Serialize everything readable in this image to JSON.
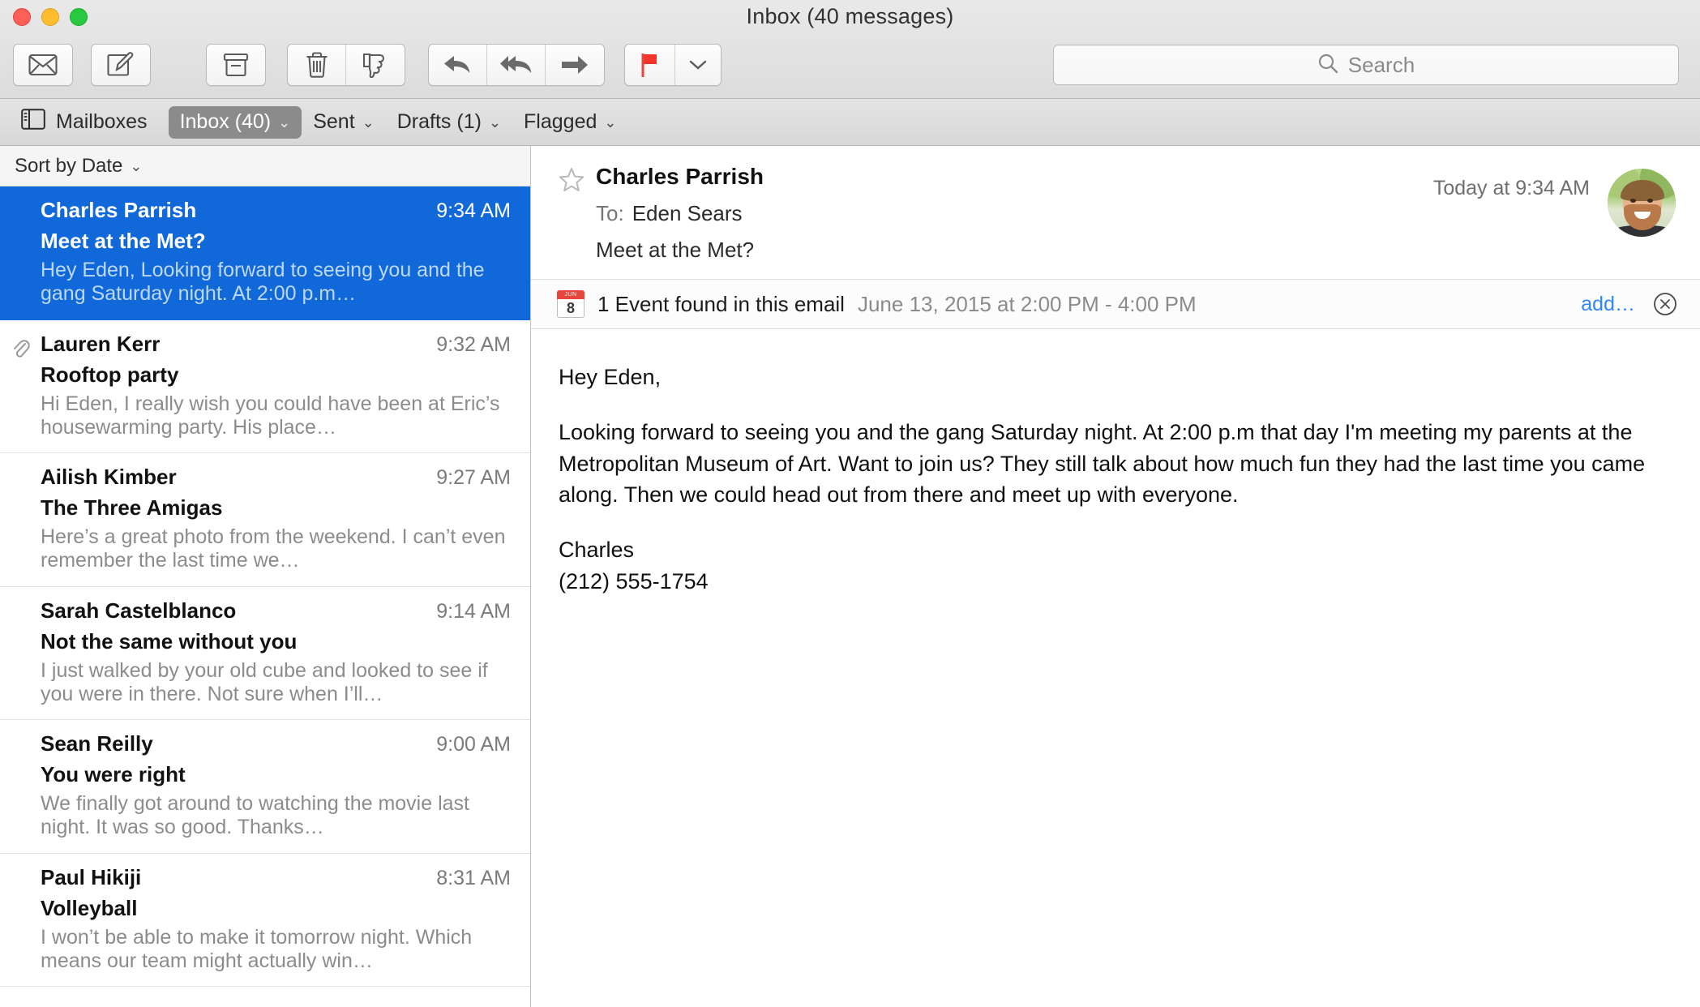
{
  "window": {
    "title": "Inbox (40 messages)",
    "traffic_lights": [
      "close",
      "minimize",
      "zoom"
    ]
  },
  "toolbar": {
    "buttons": [
      {
        "name": "get-mail-button",
        "icon": "envelope-icon",
        "label": "Get Mail"
      },
      {
        "name": "compose-button",
        "icon": "compose-icon",
        "label": "New Message"
      },
      {
        "name": "archive-button",
        "icon": "archive-box-icon",
        "label": "Archive"
      },
      {
        "name": "delete-button",
        "icon": "trash-icon",
        "label": "Delete"
      },
      {
        "name": "junk-button",
        "icon": "thumbs-down-icon",
        "label": "Mark as Junk"
      },
      {
        "name": "reply-button",
        "icon": "reply-arrow-icon",
        "label": "Reply"
      },
      {
        "name": "reply-all-button",
        "icon": "reply-all-arrow-icon",
        "label": "Reply All"
      },
      {
        "name": "forward-button",
        "icon": "forward-arrow-icon",
        "label": "Forward"
      },
      {
        "name": "flag-button",
        "icon": "red-flag-icon",
        "label": "Flag"
      },
      {
        "name": "flag-dropdown-button",
        "icon": "chevron-down-icon",
        "label": "Flag options"
      }
    ],
    "search": {
      "placeholder": "Search",
      "value": "",
      "icon": "search-icon"
    }
  },
  "favorites_bar": {
    "mailboxes": {
      "label": "Mailboxes",
      "icon": "sidebar-toggle-icon"
    },
    "items": [
      {
        "label": "Inbox (40)",
        "active": true,
        "chevron": "⌄"
      },
      {
        "label": "Sent",
        "active": false,
        "chevron": "⌄"
      },
      {
        "label": "Drafts (1)",
        "active": false,
        "chevron": "⌄"
      },
      {
        "label": "Flagged",
        "active": false,
        "chevron": "⌄"
      }
    ]
  },
  "message_list": {
    "sort": {
      "label": "Sort by Date",
      "chevron": "⌄"
    },
    "messages": [
      {
        "sender": "Charles Parrish",
        "time": "9:34 AM",
        "subject": "Meet at the Met?",
        "snippet": "Hey Eden, Looking forward to seeing you and the gang Saturday night. At 2:00 p.m…",
        "selected": true,
        "has_attachment": false
      },
      {
        "sender": "Lauren Kerr",
        "time": "9:32 AM",
        "subject": "Rooftop party",
        "snippet": "Hi Eden, I really wish you could have been at Eric’s housewarming party. His place…",
        "selected": false,
        "has_attachment": true
      },
      {
        "sender": "Ailish Kimber",
        "time": "9:27 AM",
        "subject": "The Three Amigas",
        "snippet": "Here’s a great photo from the weekend. I can’t even remember the last time we…",
        "selected": false,
        "has_attachment": false
      },
      {
        "sender": "Sarah Castelblanco",
        "time": "9:14 AM",
        "subject": "Not the same without you",
        "snippet": "I just walked by your old cube and looked to see if you were in there. Not sure when I’ll…",
        "selected": false,
        "has_attachment": false
      },
      {
        "sender": "Sean Reilly",
        "time": "9:00 AM",
        "subject": "You were right",
        "snippet": "We finally got around to watching the movie last night. It was so good. Thanks…",
        "selected": false,
        "has_attachment": false
      },
      {
        "sender": "Paul Hikiji",
        "time": "8:31 AM",
        "subject": "Volleyball",
        "snippet": "I won’t be able to make it tomorrow night. Which means our team might actually win…",
        "selected": false,
        "has_attachment": false
      }
    ]
  },
  "reading_pane": {
    "header": {
      "star_icon": "star-outline-icon",
      "from": "Charles Parrish",
      "to_label": "To:",
      "to": "Eden Sears",
      "subject": "Meet at the Met?",
      "date": "Today at 9:34 AM",
      "avatar_name": "sender-avatar"
    },
    "event_banner": {
      "icon": "calendar-icon",
      "calendar_month": "JUN",
      "calendar_day": "8",
      "title": "1 Event found in this email",
      "when": "June 13, 2015 at 2:00 PM - 4:00 PM",
      "add_label": "add…",
      "close_icon": "close-circle-icon"
    },
    "body": [
      "Hey Eden,",
      "Looking forward to seeing you and the gang Saturday night. At 2:00 p.m that day I'm meeting my parents at the Metropolitan Museum of Art. Want to join us? They still talk about how much fun they had the last time you came along. Then we could head out from there and meet up with everyone.",
      "Charles\n(212) 555-1754"
    ],
    "body_signature_name": "Charles",
    "body_signature_phone": "(212) 555-1754"
  },
  "colors": {
    "selection_blue": "#1169d9",
    "link_blue": "#2f86f6",
    "flag_red": "#e8453c",
    "active_pill_gray": "#8b8b8b"
  }
}
